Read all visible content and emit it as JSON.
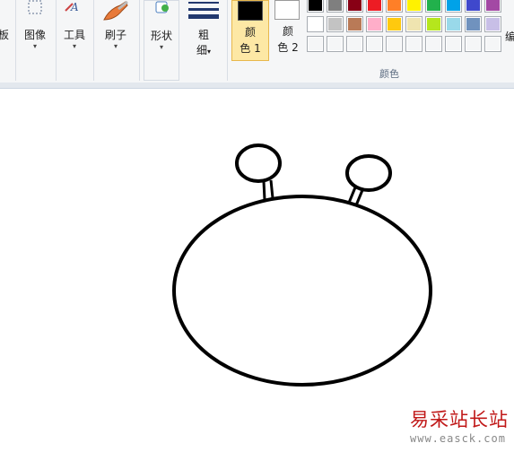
{
  "ribbon": {
    "clipboard_label": "板",
    "image_label": "图像",
    "tools_label": "工具",
    "brushes_label": "刷子",
    "shapes_label": "形状",
    "size_label_line1": "粗",
    "size_label_line2": "细",
    "color1_label_line1": "颜",
    "color1_label_line2": "色 1",
    "color2_label_line1": "颜",
    "color2_label_line2": "色 2",
    "colors_group_caption": "颜色",
    "edit_colors_label": "编",
    "dropdown_glyph": "▾"
  },
  "colors": {
    "color1": "#000000",
    "color2": "#ffffff",
    "palette_row1": [
      "#000000",
      "#7f7f7f",
      "#880015",
      "#ed1c24",
      "#ff7f27",
      "#fff200",
      "#22b14c",
      "#00a2e8",
      "#3f48cc",
      "#a349a4"
    ],
    "palette_row2": [
      "#ffffff",
      "#c3c3c3",
      "#b97a57",
      "#ffaec9",
      "#ffc90e",
      "#efe4b0",
      "#b5e61d",
      "#99d9ea",
      "#7092be",
      "#c8bfe7"
    ],
    "palette_row3": [
      "",
      "",
      "",
      "",
      "",
      "",
      "",
      "",
      "",
      ""
    ],
    "stroke": "#000000"
  },
  "watermark": {
    "brand": "易采站长站",
    "url": "www.easck.com"
  }
}
